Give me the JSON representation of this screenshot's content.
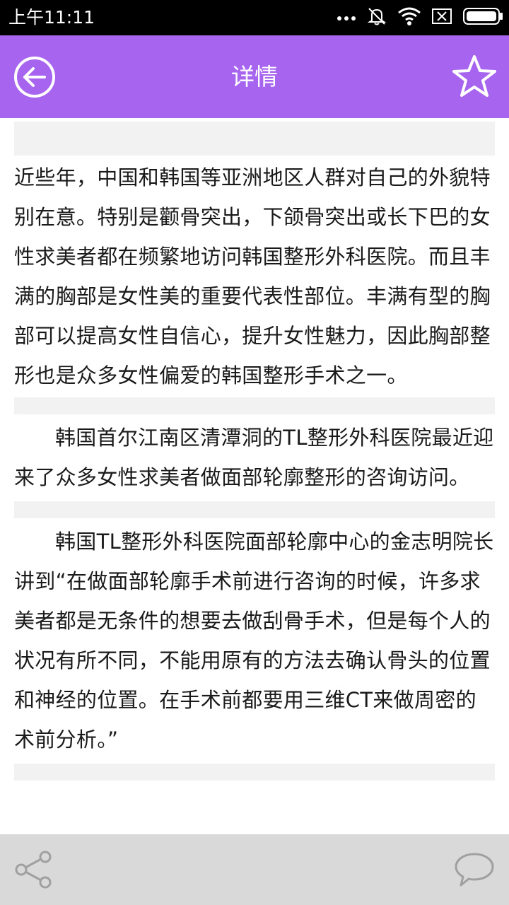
{
  "status_bar": {
    "time": "上午11:11",
    "icons": [
      "more-dots-icon",
      "silent-bell-icon",
      "wifi-icon",
      "sim-disabled-icon",
      "battery-icon"
    ]
  },
  "app_bar": {
    "title": "详情",
    "back_icon": "arrow-left-circle-icon",
    "favorite_icon": "star-outline-icon",
    "background_color": "#a764ef"
  },
  "article": {
    "paragraphs": [
      "近些年，中国和韩国等亚洲地区人群对自己的外貌特别在意。特别是颧骨突出，下颌骨突出或长下巴的女性求美者都在频繁地访问韩国整形外科医院。而且丰满的胸部是女性美的重要代表性部位。丰满有型的胸部可以提高女性自信心，提升女性魅力，因此胸部整形也是众多女性偏爱的韩国整形手术之一。",
      "韩国首尔江南区清潭洞的TL整形外科医院最近迎来了众多女性求美者做面部轮廓整形的咨询访问。",
      "韩国TL整形外科医院面部轮廓中心的金志明院长讲到“在做面部轮廓手术前进行咨询的时候，许多求美者都是无条件的想要去做刮骨手术，但是每个人的状况有所不同，不能用原有的方法去确认骨头的位置和神经的位置。在手术前都要用三维CT来做周密的术前分析。”"
    ]
  },
  "bottom_bar": {
    "share_icon": "share-icon",
    "comment_icon": "comment-bubble-icon",
    "background_color": "#d9d9d9"
  }
}
